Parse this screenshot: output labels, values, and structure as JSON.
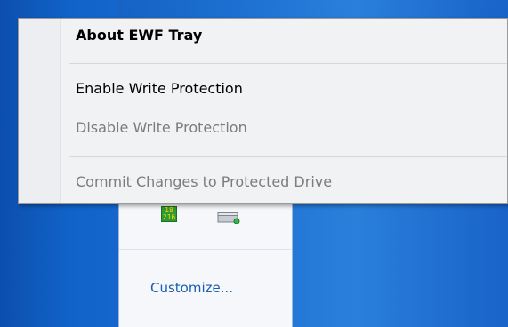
{
  "context_menu": {
    "items": [
      {
        "label": "About EWF Tray",
        "style": "bold",
        "enabled": true
      },
      {
        "label": "Enable Write Protection",
        "style": "normal",
        "enabled": true
      },
      {
        "label": "Disable Write Protection",
        "style": "normal",
        "enabled": false
      },
      {
        "label": "Commit Changes to Protected Drive",
        "style": "normal",
        "enabled": false
      }
    ]
  },
  "tray_popup": {
    "counter_icon_text": "18\n216",
    "customize_label": "Customize..."
  },
  "colors": {
    "desktop_blue": "#1b6ccf",
    "menu_bg": "#f1f2f4",
    "disabled_text": "#7c7c7c",
    "link_blue": "#1a5fb4"
  },
  "icons": {
    "counter": "green-counter-icon",
    "drive": "drive-icon"
  }
}
